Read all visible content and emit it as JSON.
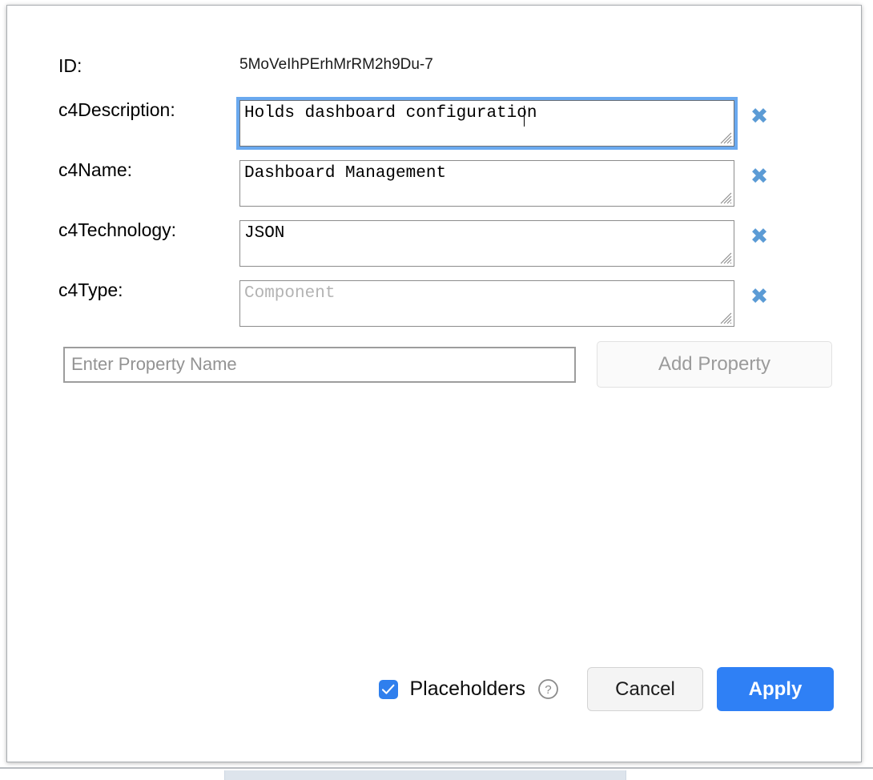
{
  "dialog": {
    "id_label": "ID:",
    "id_value": "5MoVeIhPErhMrRM2h9Du-7",
    "fields": [
      {
        "label": "c4Description:",
        "value": "Holds dashboard configuration",
        "placeholder": "",
        "focused": true,
        "delete_icon": "✖"
      },
      {
        "label": "c4Name:",
        "value": "Dashboard Management",
        "placeholder": "",
        "focused": false,
        "delete_icon": "✖"
      },
      {
        "label": "c4Technology:",
        "value": "JSON",
        "placeholder": "",
        "focused": false,
        "delete_icon": "✖"
      },
      {
        "label": "c4Type:",
        "value": "",
        "placeholder": "Component",
        "focused": false,
        "delete_icon": "✖"
      }
    ],
    "property": {
      "input_value": "",
      "input_placeholder": "Enter Property Name",
      "add_button_label": "Add Property"
    },
    "footer": {
      "placeholders_label": "Placeholders",
      "placeholders_checked": true,
      "help_icon": "question-circle",
      "cancel_label": "Cancel",
      "apply_label": "Apply"
    },
    "colors": {
      "accent": "#2f80f5",
      "focus_ring": "#6aa9ef",
      "delete_icon": "#5b9bd5",
      "placeholder_text": "#b3b3b3",
      "field_border": "#8c8c8c"
    }
  }
}
